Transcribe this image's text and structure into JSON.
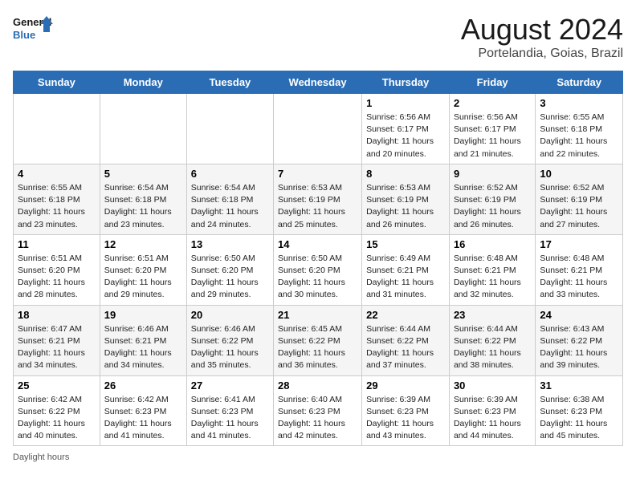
{
  "header": {
    "logo_line1": "General",
    "logo_line2": "Blue",
    "month_title": "August 2024",
    "subtitle": "Portelandia, Goias, Brazil"
  },
  "days_of_week": [
    "Sunday",
    "Monday",
    "Tuesday",
    "Wednesday",
    "Thursday",
    "Friday",
    "Saturday"
  ],
  "weeks": [
    [
      {
        "day": "",
        "info": ""
      },
      {
        "day": "",
        "info": ""
      },
      {
        "day": "",
        "info": ""
      },
      {
        "day": "",
        "info": ""
      },
      {
        "day": "1",
        "info": "Sunrise: 6:56 AM\nSunset: 6:17 PM\nDaylight: 11 hours and 20 minutes."
      },
      {
        "day": "2",
        "info": "Sunrise: 6:56 AM\nSunset: 6:17 PM\nDaylight: 11 hours and 21 minutes."
      },
      {
        "day": "3",
        "info": "Sunrise: 6:55 AM\nSunset: 6:18 PM\nDaylight: 11 hours and 22 minutes."
      }
    ],
    [
      {
        "day": "4",
        "info": "Sunrise: 6:55 AM\nSunset: 6:18 PM\nDaylight: 11 hours and 23 minutes."
      },
      {
        "day": "5",
        "info": "Sunrise: 6:54 AM\nSunset: 6:18 PM\nDaylight: 11 hours and 23 minutes."
      },
      {
        "day": "6",
        "info": "Sunrise: 6:54 AM\nSunset: 6:18 PM\nDaylight: 11 hours and 24 minutes."
      },
      {
        "day": "7",
        "info": "Sunrise: 6:53 AM\nSunset: 6:19 PM\nDaylight: 11 hours and 25 minutes."
      },
      {
        "day": "8",
        "info": "Sunrise: 6:53 AM\nSunset: 6:19 PM\nDaylight: 11 hours and 26 minutes."
      },
      {
        "day": "9",
        "info": "Sunrise: 6:52 AM\nSunset: 6:19 PM\nDaylight: 11 hours and 26 minutes."
      },
      {
        "day": "10",
        "info": "Sunrise: 6:52 AM\nSunset: 6:19 PM\nDaylight: 11 hours and 27 minutes."
      }
    ],
    [
      {
        "day": "11",
        "info": "Sunrise: 6:51 AM\nSunset: 6:20 PM\nDaylight: 11 hours and 28 minutes."
      },
      {
        "day": "12",
        "info": "Sunrise: 6:51 AM\nSunset: 6:20 PM\nDaylight: 11 hours and 29 minutes."
      },
      {
        "day": "13",
        "info": "Sunrise: 6:50 AM\nSunset: 6:20 PM\nDaylight: 11 hours and 29 minutes."
      },
      {
        "day": "14",
        "info": "Sunrise: 6:50 AM\nSunset: 6:20 PM\nDaylight: 11 hours and 30 minutes."
      },
      {
        "day": "15",
        "info": "Sunrise: 6:49 AM\nSunset: 6:21 PM\nDaylight: 11 hours and 31 minutes."
      },
      {
        "day": "16",
        "info": "Sunrise: 6:48 AM\nSunset: 6:21 PM\nDaylight: 11 hours and 32 minutes."
      },
      {
        "day": "17",
        "info": "Sunrise: 6:48 AM\nSunset: 6:21 PM\nDaylight: 11 hours and 33 minutes."
      }
    ],
    [
      {
        "day": "18",
        "info": "Sunrise: 6:47 AM\nSunset: 6:21 PM\nDaylight: 11 hours and 34 minutes."
      },
      {
        "day": "19",
        "info": "Sunrise: 6:46 AM\nSunset: 6:21 PM\nDaylight: 11 hours and 34 minutes."
      },
      {
        "day": "20",
        "info": "Sunrise: 6:46 AM\nSunset: 6:22 PM\nDaylight: 11 hours and 35 minutes."
      },
      {
        "day": "21",
        "info": "Sunrise: 6:45 AM\nSunset: 6:22 PM\nDaylight: 11 hours and 36 minutes."
      },
      {
        "day": "22",
        "info": "Sunrise: 6:44 AM\nSunset: 6:22 PM\nDaylight: 11 hours and 37 minutes."
      },
      {
        "day": "23",
        "info": "Sunrise: 6:44 AM\nSunset: 6:22 PM\nDaylight: 11 hours and 38 minutes."
      },
      {
        "day": "24",
        "info": "Sunrise: 6:43 AM\nSunset: 6:22 PM\nDaylight: 11 hours and 39 minutes."
      }
    ],
    [
      {
        "day": "25",
        "info": "Sunrise: 6:42 AM\nSunset: 6:22 PM\nDaylight: 11 hours and 40 minutes."
      },
      {
        "day": "26",
        "info": "Sunrise: 6:42 AM\nSunset: 6:23 PM\nDaylight: 11 hours and 41 minutes."
      },
      {
        "day": "27",
        "info": "Sunrise: 6:41 AM\nSunset: 6:23 PM\nDaylight: 11 hours and 41 minutes."
      },
      {
        "day": "28",
        "info": "Sunrise: 6:40 AM\nSunset: 6:23 PM\nDaylight: 11 hours and 42 minutes."
      },
      {
        "day": "29",
        "info": "Sunrise: 6:39 AM\nSunset: 6:23 PM\nDaylight: 11 hours and 43 minutes."
      },
      {
        "day": "30",
        "info": "Sunrise: 6:39 AM\nSunset: 6:23 PM\nDaylight: 11 hours and 44 minutes."
      },
      {
        "day": "31",
        "info": "Sunrise: 6:38 AM\nSunset: 6:23 PM\nDaylight: 11 hours and 45 minutes."
      }
    ]
  ],
  "footer": {
    "daylight_label": "Daylight hours"
  }
}
